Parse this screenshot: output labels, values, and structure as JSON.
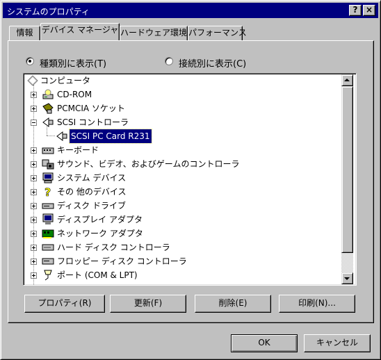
{
  "window": {
    "title": "システムのプロパティ",
    "buttons": {
      "help": "?",
      "close": "×"
    }
  },
  "tabs": [
    {
      "label": "情報"
    },
    {
      "label": "デバイス マネージャ",
      "active": true
    },
    {
      "label": "ハードウェア環境"
    },
    {
      "label": "パフォーマンス"
    }
  ],
  "view_options": {
    "by_type": "種類別に表示(T)",
    "by_connection": "接続別に表示(C)",
    "selected": "by_type"
  },
  "tree": {
    "root": "コンピュータ",
    "items": [
      {
        "label": "CD-ROM",
        "expander": "plus",
        "icon": "cdrom-icon"
      },
      {
        "label": "PCMCIA ソケット",
        "expander": "plus",
        "icon": "pcmcia-icon"
      },
      {
        "label": "SCSI コントローラ",
        "expander": "minus",
        "icon": "scsi-icon"
      },
      {
        "label": "SCSI PC Card R231",
        "child": true,
        "selected": true,
        "icon": "scsi-device-icon"
      },
      {
        "label": "キーボード",
        "expander": "plus",
        "icon": "keyboard-icon"
      },
      {
        "label": "サウンド、ビデオ、およびゲームのコントローラ",
        "expander": "plus",
        "icon": "sound-icon"
      },
      {
        "label": "システム デバイス",
        "expander": "plus",
        "icon": "system-device-icon"
      },
      {
        "label": "その 他のデバイス",
        "expander": "plus",
        "icon": "unknown-device-icon"
      },
      {
        "label": "ディスク ドライブ",
        "expander": "plus",
        "icon": "disk-drive-icon"
      },
      {
        "label": "ディスプレイ アダプタ",
        "expander": "plus",
        "icon": "display-adapter-icon"
      },
      {
        "label": "ネットワーク アダプタ",
        "expander": "plus",
        "icon": "network-adapter-icon"
      },
      {
        "label": "ハード ディスク コントローラ",
        "expander": "plus",
        "icon": "hdd-controller-icon"
      },
      {
        "label": "フロッピー ディスク コントローラ",
        "expander": "plus",
        "icon": "floppy-controller-icon"
      },
      {
        "label": "ポート (COM & LPT)",
        "expander": "plus",
        "icon": "port-icon"
      }
    ]
  },
  "action_buttons": {
    "properties": "プロパティ(R)",
    "refresh": "更新(F)",
    "remove": "削除(E)",
    "print": "印刷(N)..."
  },
  "dialog_buttons": {
    "ok": "OK",
    "cancel": "キャンセル"
  }
}
